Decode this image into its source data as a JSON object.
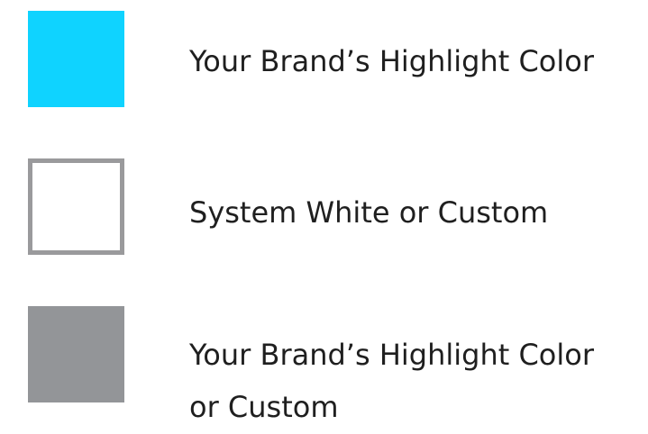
{
  "legend": [
    {
      "label": "Your Brand’s Highlight Color",
      "fill": "#0fd3ff",
      "border": "none"
    },
    {
      "label": "System White or Custom",
      "fill": "#ffffff",
      "border": "#9a9a9c"
    },
    {
      "label_line1": "Your Brand’s Highlight Color",
      "label_line2": "or Custom",
      "fill": "#939598",
      "border": "none"
    }
  ]
}
